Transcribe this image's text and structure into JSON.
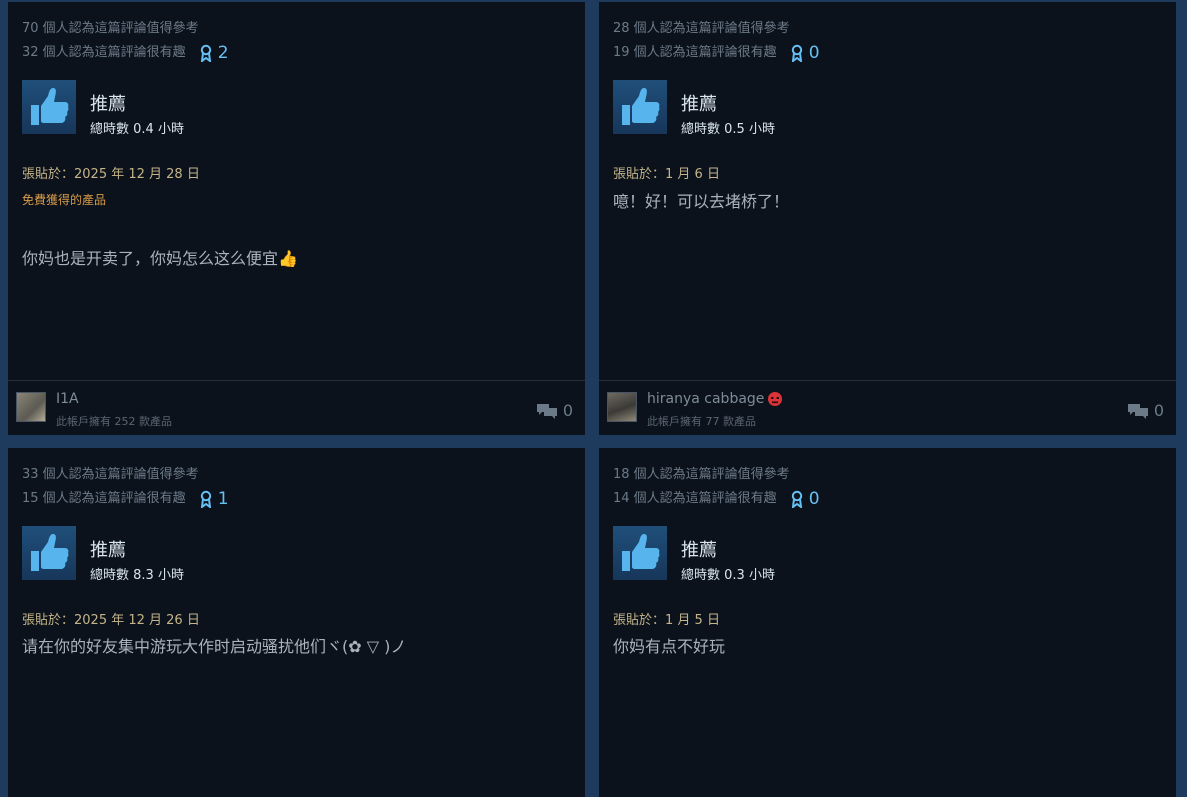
{
  "reviews": [
    {
      "helpful": "70 個人認為這篇評論值得參考",
      "funny": "32 個人認為這篇評論很有趣",
      "awards": "2",
      "verdict": "推薦",
      "hours_label": "總時數",
      "hours_value": "0.4",
      "hours_unit": "小時",
      "posted": "張貼於：2025 年 12 月 28 日",
      "free_label": "免費獲得的產品",
      "text": "你妈也是开卖了，你妈怎么这么便宜👍",
      "author": "I1A",
      "owned": "此帳戶擁有 252 款產品",
      "comments": "0"
    },
    {
      "helpful": "28 個人認為這篇評論值得參考",
      "funny": "19 個人認為這篇評論很有趣",
      "awards": "0",
      "verdict": "推薦",
      "hours_label": "總時數",
      "hours_value": "0.5",
      "hours_unit": "小時",
      "posted": "張貼於：1 月 6 日",
      "text": "噫！好！可以去堵桥了！",
      "author": "hiranya cabbage",
      "owned": "此帳戶擁有 77 款產品",
      "comments": "0"
    },
    {
      "helpful": "33 個人認為這篇評論值得參考",
      "funny": "15 個人認為這篇評論很有趣",
      "awards": "1",
      "verdict": "推薦",
      "hours_label": "總時數",
      "hours_value": "8.3",
      "hours_unit": "小時",
      "posted": "張貼於：2025 年 12 月 26 日",
      "text": "请在你的好友集中游玩大作时启动骚扰他们ヾ(✿ ▽ )ノ"
    },
    {
      "helpful": "18 個人認為這篇評論值得參考",
      "funny": "14 個人認為這篇評論很有趣",
      "awards": "0",
      "verdict": "推薦",
      "hours_label": "總時數",
      "hours_value": "0.3",
      "hours_unit": "小時",
      "posted": "張貼於：1 月 5 日",
      "text": "你妈有点不好玩"
    }
  ],
  "icons": {
    "thumb": "thumbs-up-icon",
    "award": "award-ribbon-icon",
    "comment": "comment-bubbles-icon",
    "angry": "angry-face-emoji-icon"
  },
  "colors": {
    "accent": "#66c0f4",
    "background": "#1e3a5c",
    "card": "#0b121b",
    "posted": "#c5b48a",
    "free": "#d69b48"
  }
}
